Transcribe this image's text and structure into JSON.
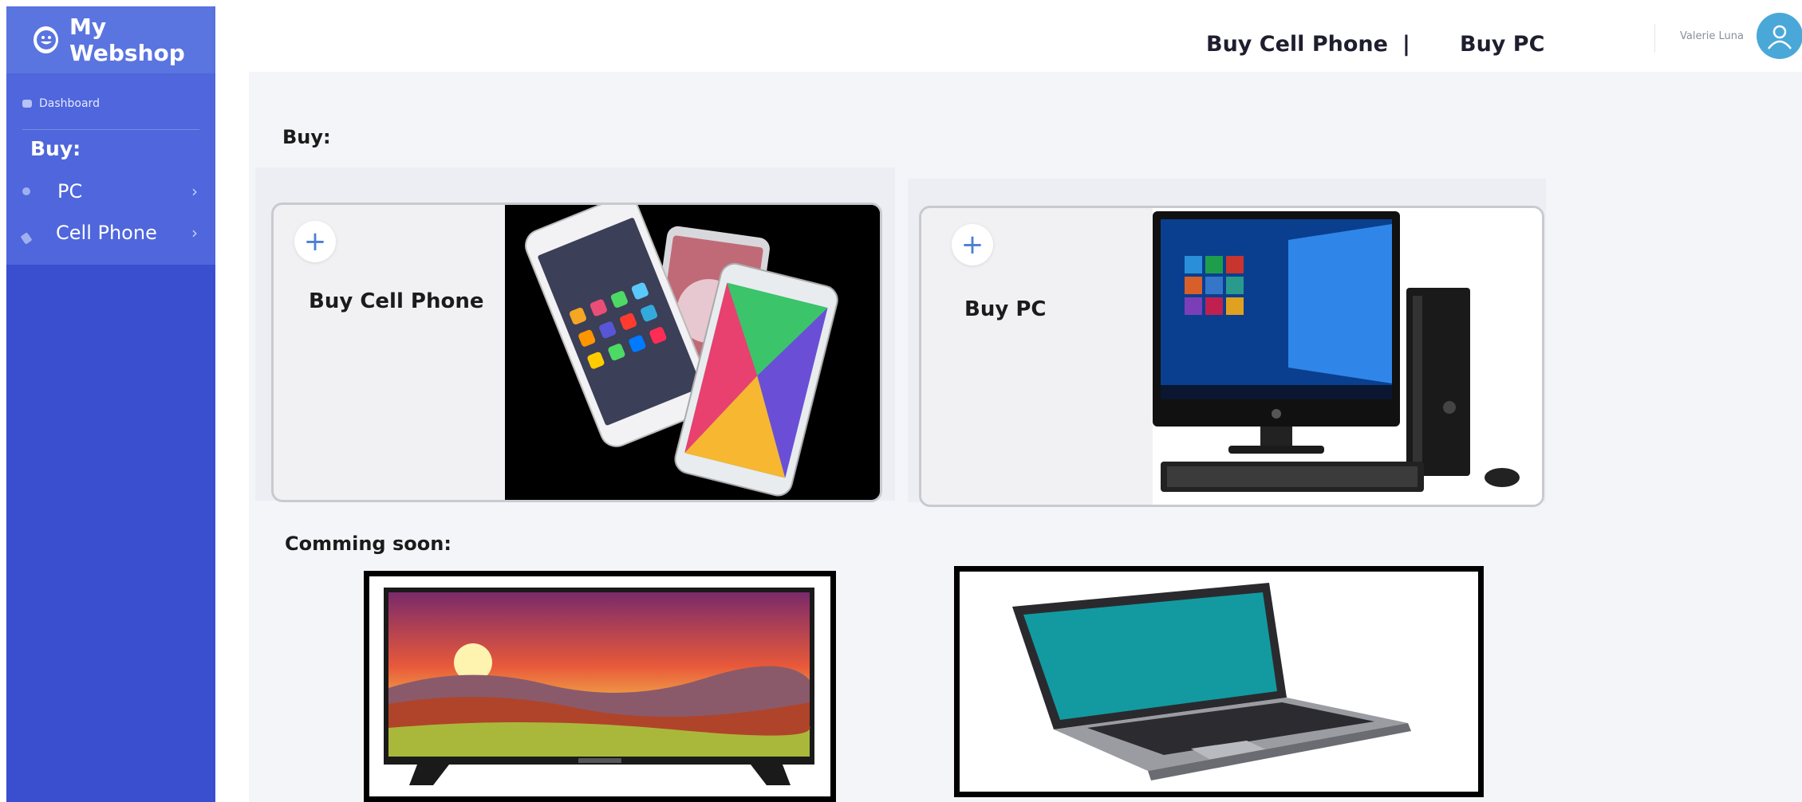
{
  "app": {
    "title": "My Webshop",
    "colors": {
      "sidebar": "#3a4fcf",
      "sidebar_header": "#5a74e0",
      "menu_bg": "#4f66dc",
      "accent": "#4a7fd4",
      "avatar": "#4aa8d8"
    }
  },
  "sidebar": {
    "dashboard_label": "Dashboard",
    "buy_heading": "Buy:",
    "items": [
      {
        "label": "PC",
        "icon": "circle-dot-icon",
        "chevron": "›"
      },
      {
        "label": "Cell Phone",
        "icon": "wrench-icon",
        "chevron": "›"
      }
    ]
  },
  "header": {
    "nav_cell_phone": "Buy Cell Phone",
    "nav_separator": "|",
    "nav_pc": "Buy PC",
    "user_name": "Valerie Luna",
    "avatar_icon": "user-icon"
  },
  "main": {
    "buy_label": "Buy:",
    "cards": [
      {
        "title": "Buy Cell Phone",
        "plus": "+",
        "image": "cell-phones-image"
      },
      {
        "title": "Buy PC",
        "plus": "+",
        "image": "desktop-pc-image"
      }
    ],
    "coming_soon_label": "Comming soon:",
    "coming_soon": [
      {
        "image": "television-image"
      },
      {
        "image": "laptop-image"
      }
    ]
  }
}
